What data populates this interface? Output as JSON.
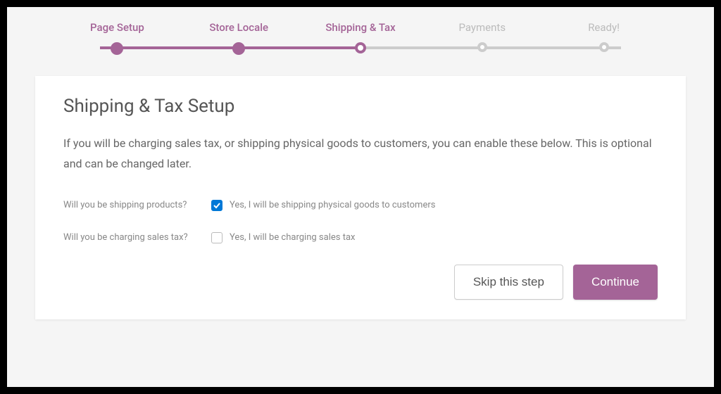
{
  "stepper": {
    "steps": [
      {
        "label": "Page Setup",
        "state": "done"
      },
      {
        "label": "Store Locale",
        "state": "done"
      },
      {
        "label": "Shipping & Tax",
        "state": "active"
      },
      {
        "label": "Payments",
        "state": "inactive"
      },
      {
        "label": "Ready!",
        "state": "inactive"
      }
    ]
  },
  "card": {
    "title": "Shipping & Tax Setup",
    "intro": "If you will be charging sales tax, or shipping physical goods to customers, you can enable these below. This is optional and can be changed later."
  },
  "form": {
    "shipping": {
      "question": "Will you be shipping products?",
      "answer": "Yes, I will be shipping physical goods to customers",
      "checked": true
    },
    "tax": {
      "question": "Will you be charging sales tax?",
      "answer": "Yes, I will be charging sales tax",
      "checked": false
    }
  },
  "buttons": {
    "skip": "Skip this step",
    "continue": "Continue"
  }
}
